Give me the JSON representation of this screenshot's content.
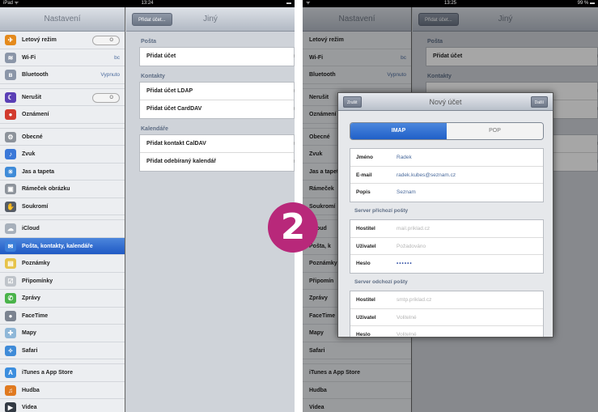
{
  "left": {
    "status": {
      "carrier": "iPad ᯤ",
      "time": "13:24",
      "battery": "▬"
    },
    "master_title": "Nastavení",
    "detail_title": "Jiný",
    "back_label": "Přidat účet...",
    "sidebar": [
      {
        "label": "Letový režim",
        "icon": "airplane-icon",
        "glyph": "✈",
        "color": "#e48a1c",
        "toggle": "O"
      },
      {
        "label": "Wi-Fi",
        "icon": "wifi-icon",
        "glyph": "≋",
        "color": "#8b96a8",
        "value": "bc"
      },
      {
        "label": "Bluetooth",
        "icon": "bluetooth-icon",
        "glyph": "ʙ",
        "color": "#8b96a8",
        "value": "Vypnuto"
      },
      {
        "gap": true
      },
      {
        "label": "Nerušit",
        "icon": "moon-icon",
        "glyph": "☾",
        "color": "#5a3fb5",
        "toggle": "O"
      },
      {
        "label": "Oznámení",
        "icon": "notifications-icon",
        "glyph": "●",
        "color": "#d23b2e"
      },
      {
        "gap": true
      },
      {
        "label": "Obecné",
        "icon": "gear-icon",
        "glyph": "⚙",
        "color": "#8d939b"
      },
      {
        "label": "Zvuk",
        "icon": "sound-icon",
        "glyph": "♪",
        "color": "#3b78d8"
      },
      {
        "label": "Jas a tapeta",
        "icon": "brightness-icon",
        "glyph": "☀",
        "color": "#3f8bd8"
      },
      {
        "label": "Rámeček obrázku",
        "icon": "picture-frame-icon",
        "glyph": "▣",
        "color": "#8d939b"
      },
      {
        "label": "Soukromí",
        "icon": "privacy-icon",
        "glyph": "✋",
        "color": "#555c66"
      },
      {
        "gap": true
      },
      {
        "label": "iCloud",
        "icon": "cloud-icon",
        "glyph": "☁",
        "color": "#a7b0bb"
      },
      {
        "label": "Pošta, kontakty, kalendáře",
        "icon": "mail-icon",
        "glyph": "✉",
        "color": "#3c7fd9",
        "selected": true
      },
      {
        "label": "Poznámky",
        "icon": "notes-icon",
        "glyph": "▤",
        "color": "#e6c34a"
      },
      {
        "label": "Připomínky",
        "icon": "reminders-icon",
        "glyph": "☑",
        "color": "#bfc4ca"
      },
      {
        "label": "Zprávy",
        "icon": "messages-icon",
        "glyph": "✆",
        "color": "#4ab34a"
      },
      {
        "label": "FaceTime",
        "icon": "facetime-icon",
        "glyph": "●",
        "color": "#7b8390"
      },
      {
        "label": "Mapy",
        "icon": "maps-icon",
        "glyph": "✚",
        "color": "#8fb7d8"
      },
      {
        "label": "Safari",
        "icon": "safari-icon",
        "glyph": "✧",
        "color": "#3f8bd8"
      },
      {
        "gap": true
      },
      {
        "label": "iTunes a App Store",
        "icon": "app-store-icon",
        "glyph": "A",
        "color": "#3c8ede"
      },
      {
        "label": "Hudba",
        "icon": "music-icon",
        "glyph": "♫",
        "color": "#e07a20"
      },
      {
        "label": "Videa",
        "icon": "video-icon",
        "glyph": "▶",
        "color": "#333a44"
      }
    ],
    "sections": [
      {
        "header": "Pošta",
        "items": [
          "Přidat účet"
        ]
      },
      {
        "header": "Kontakty",
        "items": [
          "Přidat účet LDAP",
          "Přidat účet CardDAV"
        ]
      },
      {
        "header": "Kalendáře",
        "items": [
          "Přidat kontakt CalDAV",
          "Přidat odebíraný kalendář"
        ]
      }
    ]
  },
  "right": {
    "status": {
      "carrier": "ᯤ",
      "time": "13:25",
      "battery": "99 % ▬"
    },
    "master_title": "Nastavení",
    "detail_title": "Jiný",
    "back_label": "Přidat účet...",
    "sidebar": [
      "Letový režim",
      "Wi-Fi",
      "Bluetooth",
      "Nerušit",
      "Oznámení",
      "Obecné",
      "Zvuk",
      "Jas a tapeta",
      "Rámeček",
      "Soukromí",
      "iCloud",
      "Pošta, k",
      "Poznámky",
      "Připomín",
      "Zprávy",
      "FaceTime",
      "Mapy",
      "Safari",
      "iTunes a App Store",
      "Hudba",
      "Videa"
    ],
    "sidebar_values": {
      "Wi-Fi": "bc",
      "Bluetooth": "Vypnuto"
    },
    "sections": [
      {
        "header": "Pošta",
        "items": [
          "Přidat účet"
        ]
      },
      {
        "header": "Kontakty",
        "items": [
          "",
          ""
        ]
      },
      {
        "header": "",
        "items": [
          "",
          ""
        ]
      }
    ],
    "modal": {
      "title": "Nový účet",
      "cancel": "Zrušit",
      "done": "Další",
      "tabs": [
        "IMAP",
        "POP"
      ],
      "account": [
        {
          "label": "Jméno",
          "value": "Radek"
        },
        {
          "label": "E-mail",
          "value": "radek.kubes@seznam.cz"
        },
        {
          "label": "Popis",
          "value": "Seznam"
        }
      ],
      "incoming_header": "Server příchozí pošty",
      "incoming": [
        {
          "label": "Hostitel",
          "placeholder": "mail.priklad.cz"
        },
        {
          "label": "Uživatel",
          "placeholder": "Požadováno"
        },
        {
          "label": "Heslo",
          "password": "••••••"
        }
      ],
      "outgoing_header": "Server odchozí pošty",
      "outgoing": [
        {
          "label": "Hostitel",
          "placeholder": "smtp.priklad.cz"
        },
        {
          "label": "Uživatel",
          "placeholder": "Volitelné"
        },
        {
          "label": "Heslo",
          "placeholder": "Volitelné"
        }
      ]
    }
  },
  "step_badge": "2"
}
